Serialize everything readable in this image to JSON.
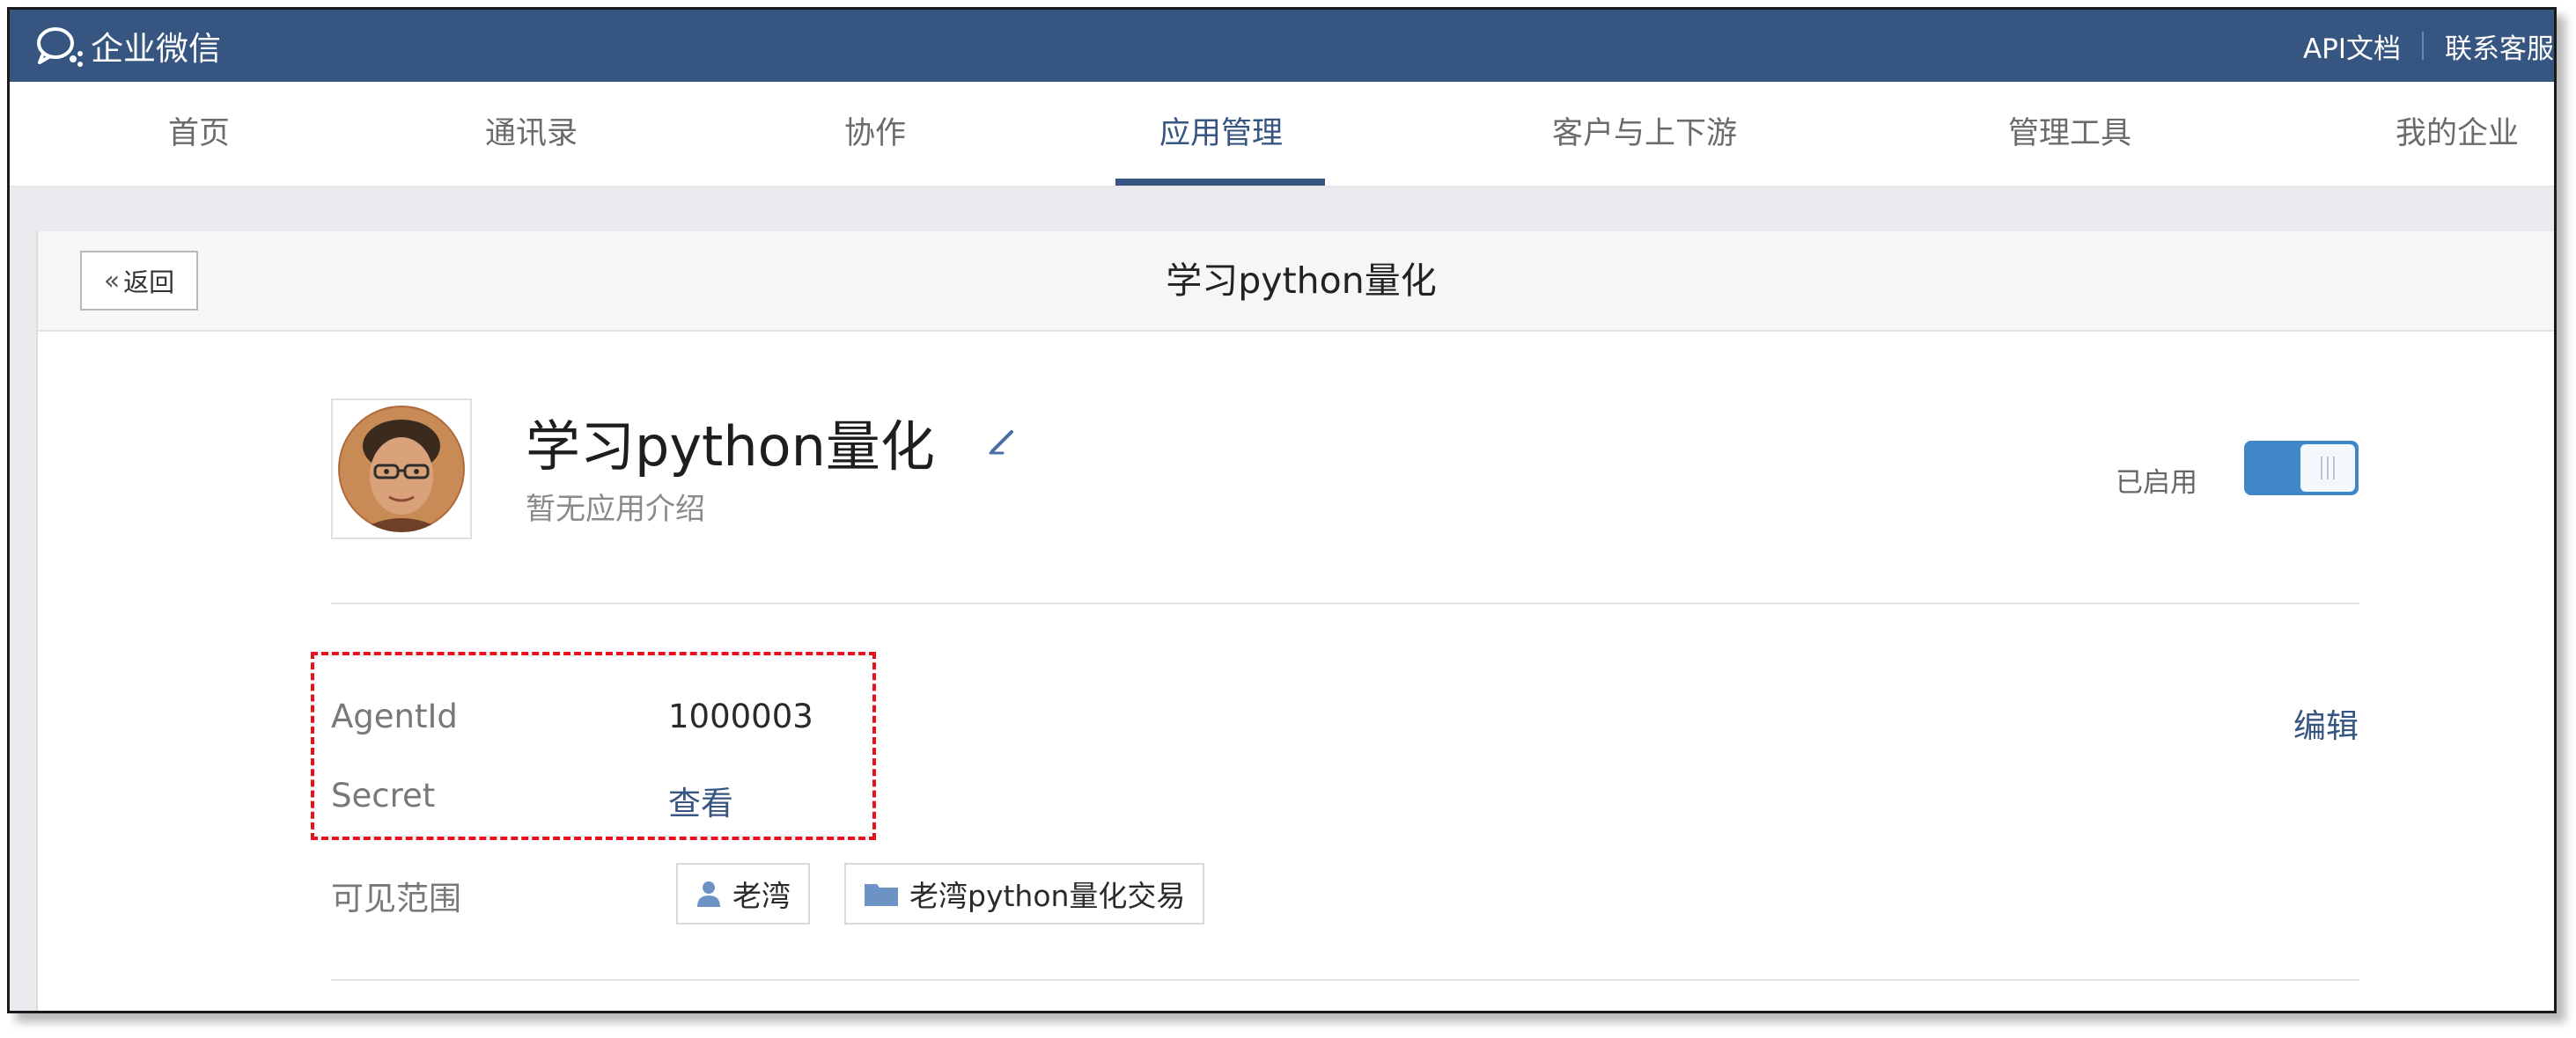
{
  "brand": {
    "name": "企业微信"
  },
  "top_links": {
    "api_docs": "API文档",
    "contact": "联系客服"
  },
  "nav": {
    "items": [
      {
        "label": "首页"
      },
      {
        "label": "通讯录"
      },
      {
        "label": "协作"
      },
      {
        "label": "应用管理"
      },
      {
        "label": "客户与上下游"
      },
      {
        "label": "管理工具"
      },
      {
        "label": "我的企业"
      }
    ],
    "active_index": 3
  },
  "page": {
    "back_label": "返回",
    "title": "学习python量化"
  },
  "app": {
    "name": "学习python量化",
    "description": "暂无应用介绍",
    "status_label": "已启用",
    "enabled": true,
    "edit_label": "编辑",
    "agent_id_label": "AgentId",
    "agent_id_value": "1000003",
    "secret_label": "Secret",
    "secret_action": "查看",
    "visibility_label": "可见范围",
    "visibility": [
      {
        "type": "user",
        "icon": "user-icon",
        "label": "老湾"
      },
      {
        "type": "department",
        "icon": "folder-icon",
        "label": "老湾python量化交易"
      }
    ]
  },
  "colors": {
    "brand_bar": "#365580",
    "toggle_on": "#3f87c6",
    "highlight_dash": "#e8101a"
  }
}
